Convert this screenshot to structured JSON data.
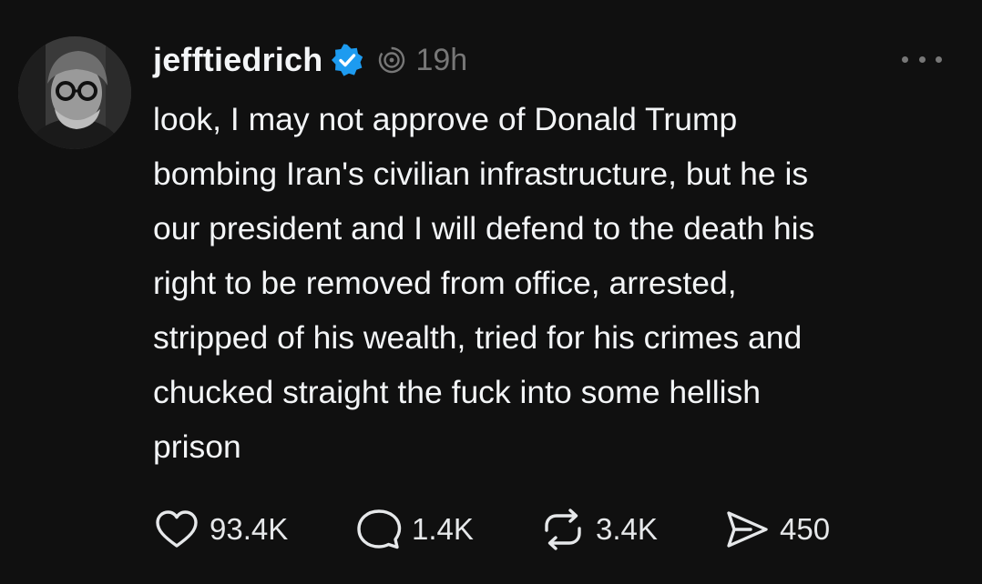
{
  "post": {
    "username": "jefftiedrich",
    "timestamp": "19h",
    "text_lines": [
      "look, I may not approve of Donald Trump",
      "bombing Iran's civilian infrastructure, but he is",
      "our president and I will defend to the death his",
      "right to be removed from office, arrested,",
      "stripped of his wealth, tried for his crimes and",
      "chucked straight the fuck into some hellish",
      "prison"
    ],
    "icons": {
      "verified": "verified-badge-icon",
      "threads": "threads-glyph-icon",
      "more": "more-options-icon",
      "like": "heart-icon",
      "reply": "comment-icon",
      "repost": "repost-icon",
      "share": "send-icon"
    },
    "colors": {
      "background": "#101010",
      "text": "#f3f5f7",
      "muted": "#777777",
      "verified": "#1d9bf0"
    }
  },
  "actions": {
    "likes": "93.4K",
    "replies": "1.4K",
    "reposts": "3.4K",
    "shares": "450"
  }
}
